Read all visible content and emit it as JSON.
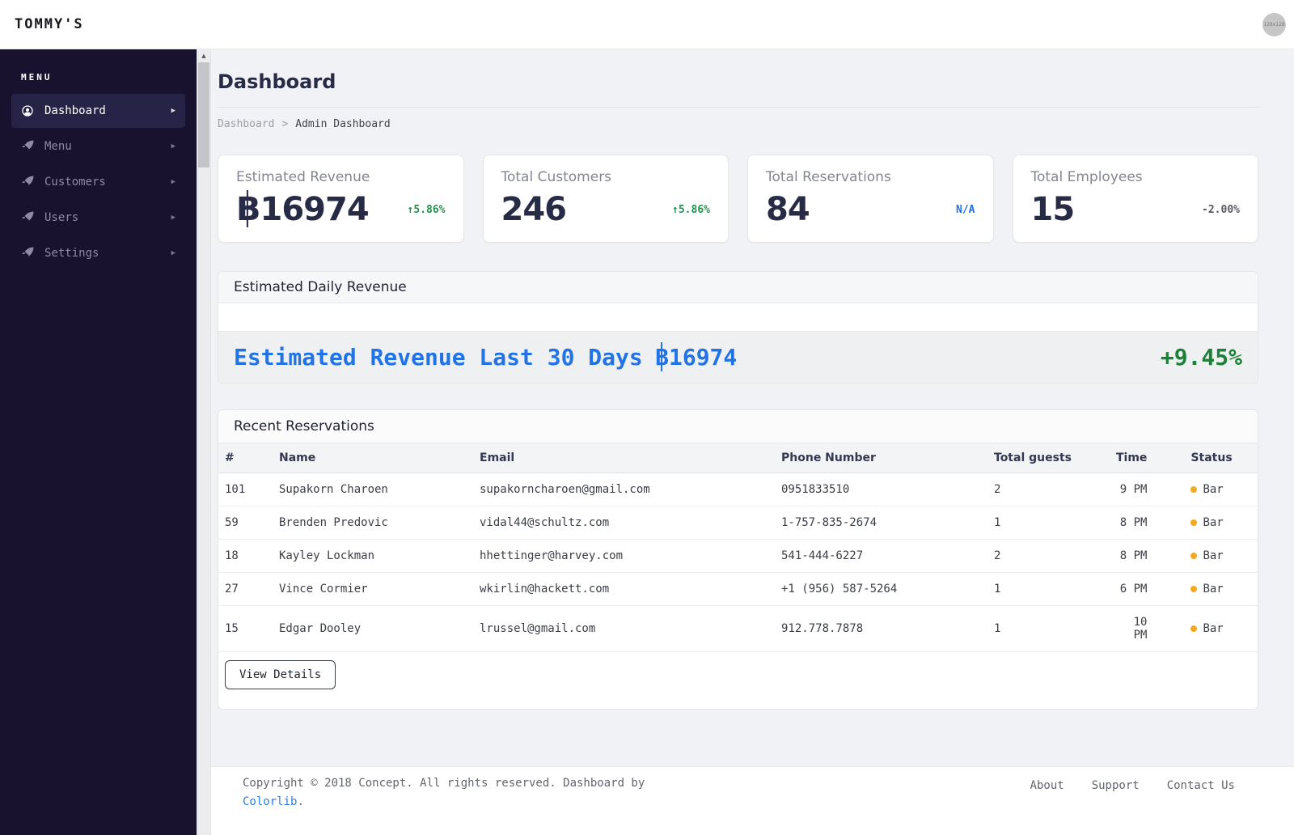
{
  "brand": "TOMMY'S",
  "header": {
    "avatar_label": "128x128"
  },
  "sidebar": {
    "menu_label": "MENU",
    "items": [
      {
        "label": "Dashboard",
        "icon": "user-circle-icon",
        "active": true
      },
      {
        "label": "Menu",
        "icon": "rocket-icon",
        "active": false
      },
      {
        "label": "Customers",
        "icon": "rocket-icon",
        "active": false
      },
      {
        "label": "Users",
        "icon": "rocket-icon",
        "active": false
      },
      {
        "label": "Settings",
        "icon": "rocket-icon",
        "active": false
      }
    ]
  },
  "page": {
    "title": "Dashboard",
    "breadcrumb": {
      "parent": "Dashboard",
      "separator": ">",
      "current": "Admin Dashboard"
    }
  },
  "stats": [
    {
      "label": "Estimated Revenue",
      "currency": "฿",
      "value": "16974",
      "trend": "↑5.86%",
      "trend_color": "#24934e"
    },
    {
      "label": "Total Customers",
      "currency": "",
      "value": "246",
      "trend": "↑5.86%",
      "trend_color": "#24934e"
    },
    {
      "label": "Total Reservations",
      "currency": "",
      "value": "84",
      "trend": "N/A",
      "trend_color": "#1f6fe8"
    },
    {
      "label": "Total Employees",
      "currency": "",
      "value": "15",
      "trend": "-2.00%",
      "trend_color": "#565a61"
    }
  ],
  "daily_revenue": {
    "title": "Estimated Daily Revenue",
    "summary_prefix": "Estimated Revenue Last 30 Days",
    "currency": "฿",
    "summary_amount": "16974",
    "change": "+9.45%",
    "summary_color": "#2173e6",
    "change_color": "#1d8138"
  },
  "reservations": {
    "title": "Recent Reservations",
    "columns": [
      "#",
      "Name",
      "Email",
      "Phone Number",
      "Total guests",
      "Time",
      "Status"
    ],
    "rows": [
      {
        "id": "101",
        "name": "Supakorn Charoen",
        "email": "supakorncharoen@gmail.com",
        "phone": "0951833510",
        "guests": "2",
        "time": "9 PM",
        "status": "Bar"
      },
      {
        "id": "59",
        "name": "Brenden Predovic",
        "email": "vidal44@schultz.com",
        "phone": "1-757-835-2674",
        "guests": "1",
        "time": "8 PM",
        "status": "Bar"
      },
      {
        "id": "18",
        "name": "Kayley Lockman",
        "email": "hhettinger@harvey.com",
        "phone": "541-444-6227",
        "guests": "2",
        "time": "8 PM",
        "status": "Bar"
      },
      {
        "id": "27",
        "name": "Vince Cormier",
        "email": "wkirlin@hackett.com",
        "phone": "+1 (956) 587-5264",
        "guests": "1",
        "time": "6 PM",
        "status": "Bar"
      },
      {
        "id": "15",
        "name": "Edgar Dooley",
        "email": "lrussel@gmail.com",
        "phone": "912.778.7878",
        "guests": "1",
        "time": "10 PM",
        "status": "Bar"
      }
    ],
    "status_dot_color": "#f6a821",
    "view_details_label": "View Details"
  },
  "footer": {
    "copyright_prefix": "Copyright © 2018 Concept. All rights reserved. Dashboard by",
    "copyright_link": "Colorlib",
    "copyright_suffix": ".",
    "links": [
      "About",
      "Support",
      "Contact Us"
    ]
  },
  "colors": {
    "sidebar_bg": "#18122f",
    "sidebar_active_bg": "#272347",
    "content_bg": "#f1f2f5",
    "accent_blue": "#2173e6",
    "green": "#24934e",
    "amber_status": "#f6a821",
    "navy_text": "#272b46"
  }
}
